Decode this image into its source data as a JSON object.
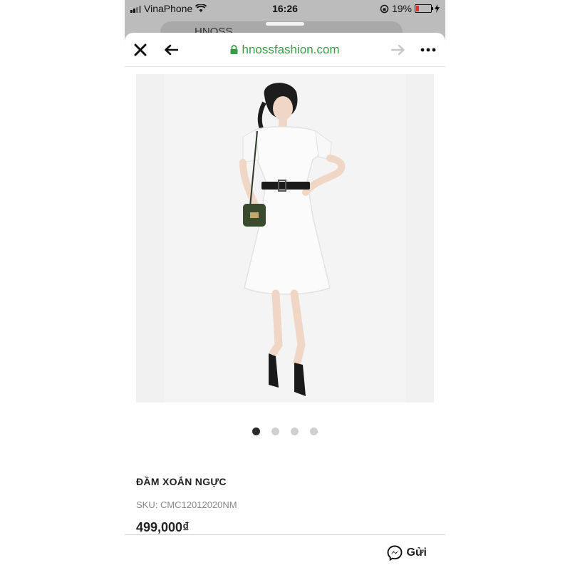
{
  "status_bar": {
    "carrier": "VinaPhone",
    "time": "16:26",
    "battery_percent": "19%",
    "battery_level": 0.19
  },
  "background_tab": {
    "address_text": "HNOSS"
  },
  "browser": {
    "url": "hnossfashion.com"
  },
  "carousel": {
    "total": 4,
    "active_index": 0
  },
  "product": {
    "name": "ĐẦM XOẮN NGỰC",
    "sku": "SKU: CMC12012020NM",
    "price": "499,000₫"
  },
  "share": {
    "send_label": "Gửi"
  },
  "colors": {
    "url_green": "#3b9a48",
    "battery_red": "#e0312b"
  }
}
